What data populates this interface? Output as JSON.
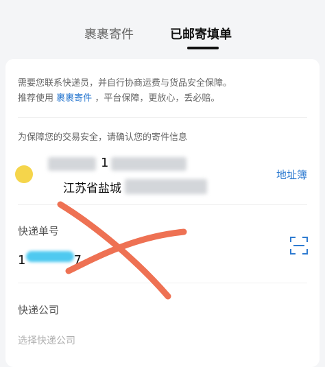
{
  "tabs": [
    {
      "label": "裹裹寄件",
      "active": false
    },
    {
      "label": "已邮寄填单",
      "active": true
    }
  ],
  "notice": {
    "line1": "需要您联系快递员，并自行协商运费与货品安全保障。",
    "line2_prefix": "推荐使用",
    "line2_link": "裹裹寄件",
    "line2_suffix": "，平台保障，更放心，丢必赔。"
  },
  "confirm_text": "为保障您的交易安全，请确认您的寄件信息",
  "sender": {
    "phone_prefix": "1",
    "province_prefix": "江苏省盐城"
  },
  "address_book_label": "地址簿",
  "tracking": {
    "label": "快递单号",
    "value_prefix": "1",
    "value_suffix": "7"
  },
  "courier": {
    "label": "快递公司",
    "placeholder": "选择快递公司"
  },
  "colors": {
    "accent_blue": "#2e7bd1",
    "cross_red": "#ee7153"
  }
}
